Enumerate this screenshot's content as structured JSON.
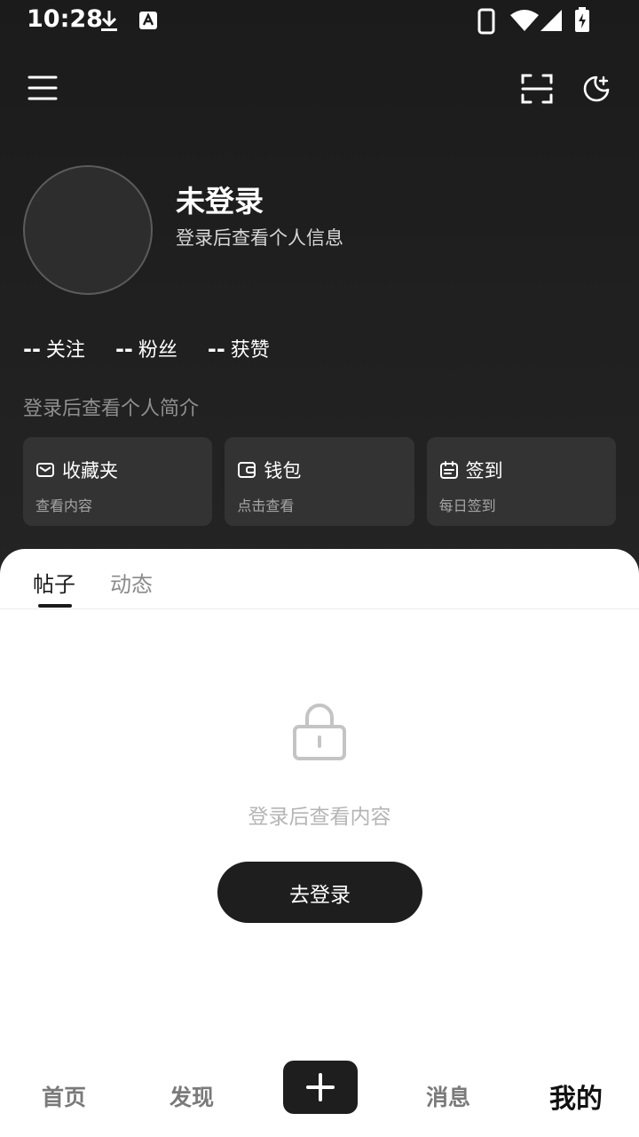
{
  "status_bar": {
    "time": "10:28"
  },
  "profile": {
    "name": "未登录",
    "subtitle": "登录后查看个人信息",
    "bio": "登录后查看个人简介"
  },
  "stats": [
    {
      "value": "--",
      "label": "关注"
    },
    {
      "value": "--",
      "label": "粉丝"
    },
    {
      "value": "--",
      "label": "获赞"
    }
  ],
  "cards": [
    {
      "title": "收藏夹",
      "sub": "查看内容",
      "icon": "mail-icon"
    },
    {
      "title": "钱包",
      "sub": "点击查看",
      "icon": "wallet-icon"
    },
    {
      "title": "签到",
      "sub": "每日签到",
      "icon": "calendar-icon"
    }
  ],
  "tabs": [
    {
      "label": "帖子",
      "active": true
    },
    {
      "label": "动态",
      "active": false
    }
  ],
  "empty_state": {
    "message": "登录后查看内容",
    "button": "去登录"
  },
  "bottom_nav": [
    {
      "label": "首页"
    },
    {
      "label": "发现"
    },
    {
      "label": "消息"
    },
    {
      "label": "我的",
      "active": true
    }
  ],
  "colors": {
    "header_bg": "#1b1b1b",
    "card_bg": "#333333",
    "accent_dark": "#1e1e1e"
  }
}
